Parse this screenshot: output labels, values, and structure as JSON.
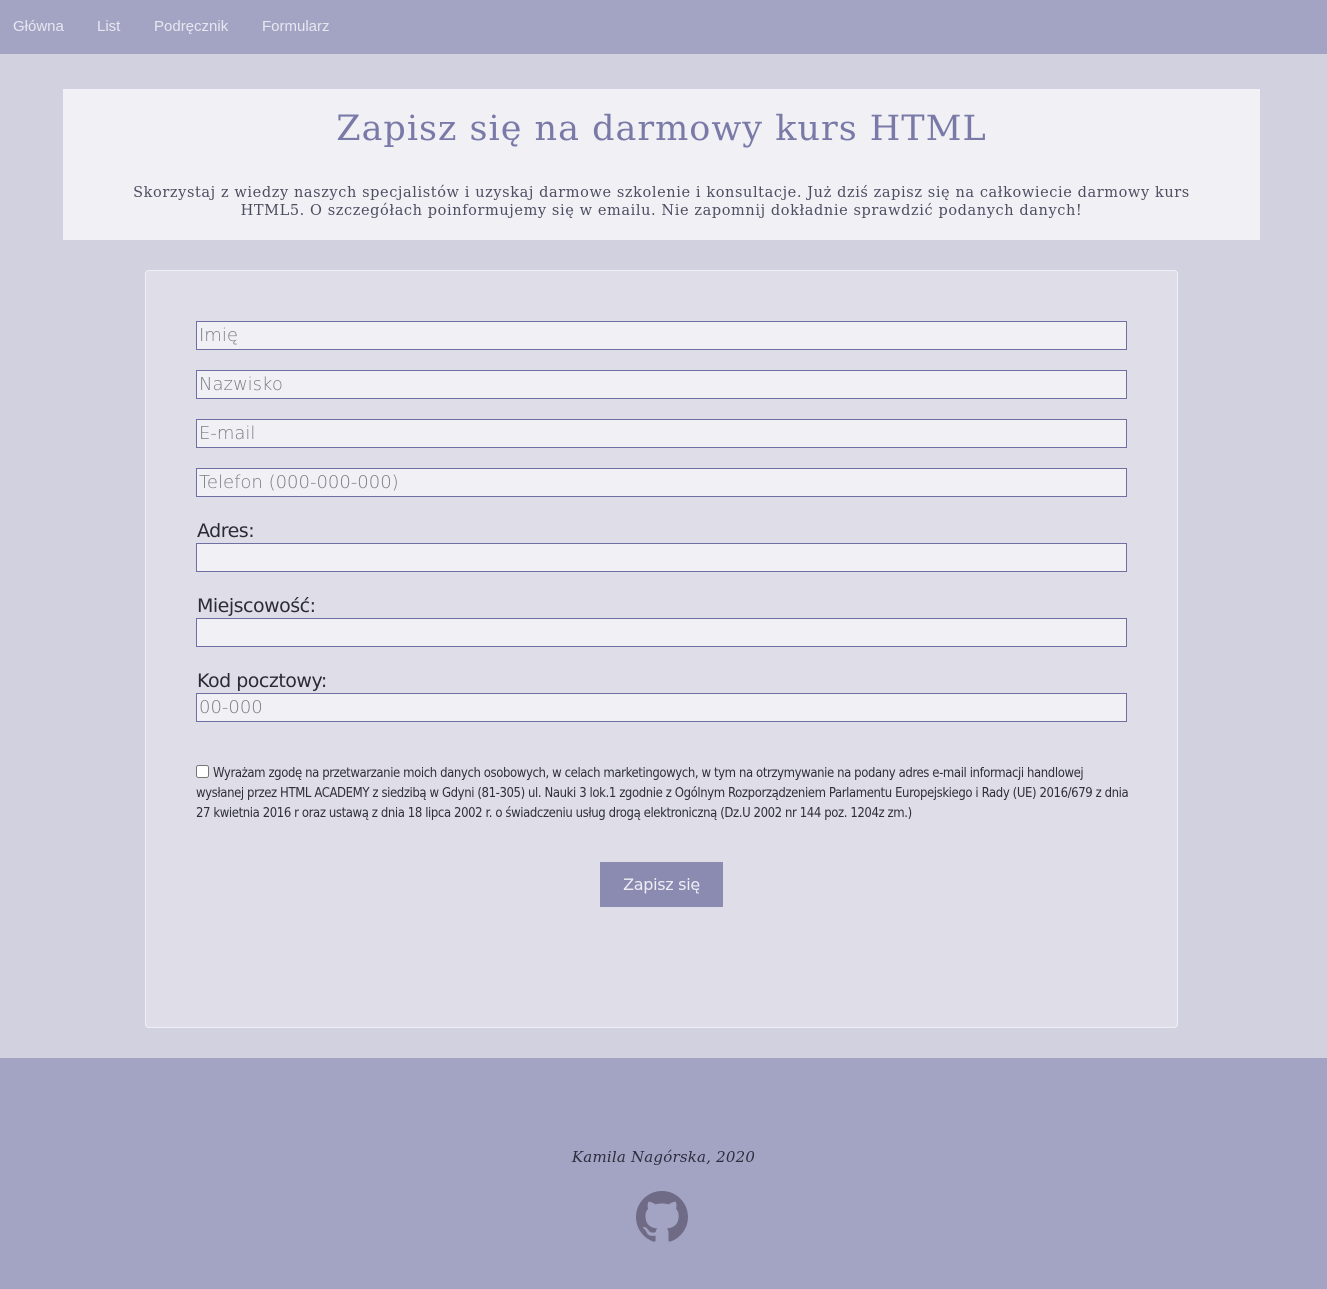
{
  "nav": {
    "items": [
      {
        "label": "Główna"
      },
      {
        "label": "List"
      },
      {
        "label": "Podręcznik"
      },
      {
        "label": "Formularz"
      }
    ]
  },
  "hero": {
    "title": "Zapisz się na darmowy kurs HTML",
    "description": "Skorzystaj z wiedzy naszych specjalistów i uzyskaj darmowe szkolenie i konsultacje. Już dziś zapisz się na całkowiecie darmowy kurs HTML5. O szczegółach poinformujemy się w emailu. Nie zapomnij dokładnie sprawdzić podanych danych!"
  },
  "form": {
    "first_name": {
      "placeholder": "Imię",
      "value": ""
    },
    "last_name": {
      "placeholder": "Nazwisko",
      "value": ""
    },
    "email": {
      "placeholder": "E-mail",
      "value": ""
    },
    "phone": {
      "placeholder": "Telefon (000-000-000)",
      "value": ""
    },
    "address": {
      "label": "Adres:",
      "value": ""
    },
    "city": {
      "label": "Miejscowość:",
      "value": ""
    },
    "postal_code": {
      "label": "Kod pocztowy:",
      "placeholder": "00-000",
      "value": ""
    },
    "consent": {
      "checked": false,
      "text": "Wyrażam zgodę na przetwarzanie moich danych osobowych, w celach marketingowych, w tym na otrzymywanie na podany adres e-mail informacji handlowej wysłanej przez HTML ACADEMY z siedzibą w Gdyni (81-305) ul. Nauki 3 lok.1 zgodnie z Ogólnym Rozporządzeniem Parlamentu Europejskiego i Rady (UE) 2016/679 z dnia 27 kwietnia 2016 r oraz ustawą z dnia 18 lipca 2002 r. o świadczeniu usług drogą elektroniczną (Dz.U 2002 nr 144 poz. 1204z zm.)"
    },
    "submit_label": "Zapisz się"
  },
  "footer": {
    "credit": "Kamila Nagórska, 2020",
    "icon": "github-icon"
  },
  "colors": {
    "nav_bg": "#a3a4c3",
    "page_bg": "#d2d1df",
    "hero_bg": "#f1f0f5",
    "title": "#7a7aa8",
    "card_bg": "#dfdee8",
    "button_bg": "#8b8ab1",
    "input_border": "#6f6fa3"
  }
}
